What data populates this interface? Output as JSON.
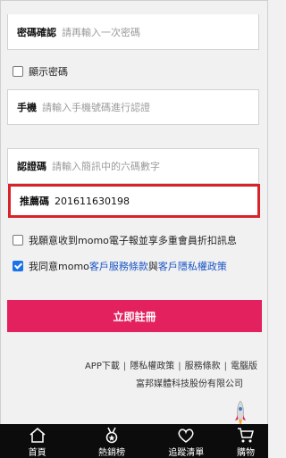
{
  "form": {
    "confirm_password": {
      "label": "密碼確認",
      "placeholder": "請再輸入一次密碼"
    },
    "show_password": {
      "label": "顯示密碼",
      "checked": false
    },
    "phone": {
      "label": "手機",
      "placeholder": "請輸入手機號碼進行認證"
    },
    "verify_code": {
      "label": "認證碼",
      "placeholder": "請輸入簡訊中的六碼數字"
    },
    "referral": {
      "label": "推薦碼",
      "value": "201611630198"
    },
    "newsletter": {
      "label": "我願意收到momo電子報並享多重會員折扣訊息",
      "checked": false
    },
    "agree": {
      "prefix": "我同意momo",
      "terms_link": "客戶服務條款",
      "and": "與",
      "privacy_link": "客戶隱私權政策",
      "checked": true
    },
    "register_button": "立即註冊"
  },
  "footer": {
    "links": [
      "APP下載",
      "隱私權政策",
      "服務條款",
      "電腦版"
    ],
    "company": "富邦媒體科技股份有限公司"
  },
  "bottom_nav": [
    {
      "label": "首頁",
      "icon": "home-icon"
    },
    {
      "label": "熱銷榜",
      "icon": "medal-icon"
    },
    {
      "label": "追蹤清單",
      "icon": "heart-icon"
    },
    {
      "label": "購物",
      "icon": "cart-icon"
    }
  ],
  "colors": {
    "accent": "#e2215e",
    "highlight_border": "#d7242b",
    "link": "#1a55c8",
    "nav_bg": "#0c0c0c"
  }
}
